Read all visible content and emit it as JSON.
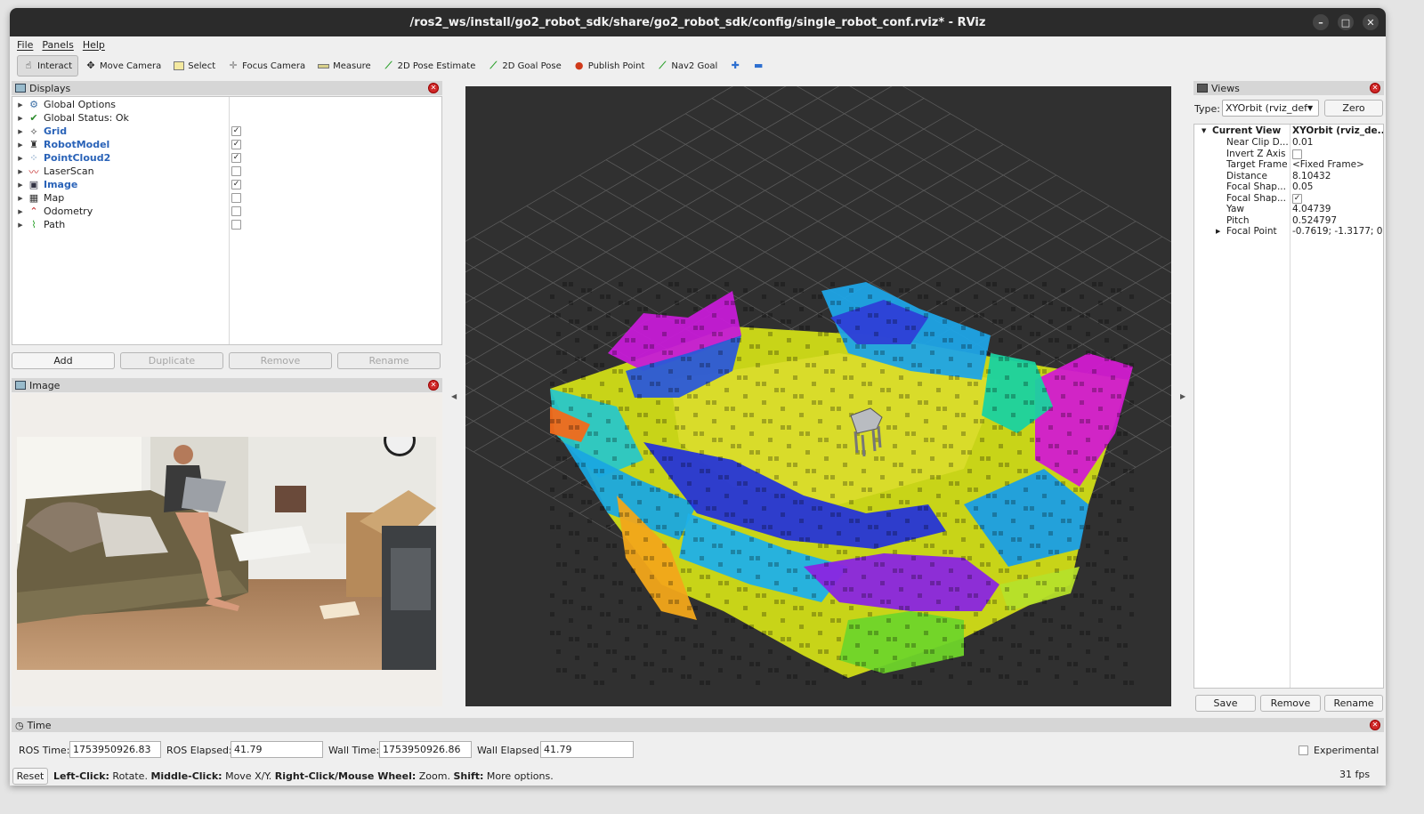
{
  "window": {
    "title": "/ros2_ws/install/go2_robot_sdk/share/go2_robot_sdk/config/single_robot_conf.rviz* - RViz"
  },
  "menu": [
    "File",
    "Panels",
    "Help"
  ],
  "toolbar": [
    {
      "label": "Interact",
      "icon": "cursor-icon"
    },
    {
      "label": "Move Camera",
      "icon": "move-icon"
    },
    {
      "label": "Select",
      "icon": "select-icon"
    },
    {
      "label": "Focus Camera",
      "icon": "focus-icon"
    },
    {
      "label": "Measure",
      "icon": "ruler-icon"
    },
    {
      "label": "2D Pose Estimate",
      "icon": "pose-arrow-icon"
    },
    {
      "label": "2D Goal Pose",
      "icon": "goal-arrow-icon"
    },
    {
      "label": "Publish Point",
      "icon": "pin-icon"
    },
    {
      "label": "Nav2 Goal",
      "icon": "nav-arrow-icon"
    }
  ],
  "displays": {
    "title": "Displays",
    "items": [
      {
        "label": "Global Options",
        "checked": null,
        "blue": false
      },
      {
        "label": "Global Status: Ok",
        "checked": null,
        "blue": false
      },
      {
        "label": "Grid",
        "checked": true,
        "blue": true
      },
      {
        "label": "RobotModel",
        "checked": true,
        "blue": true
      },
      {
        "label": "PointCloud2",
        "checked": true,
        "blue": true
      },
      {
        "label": "LaserScan",
        "checked": false,
        "blue": false
      },
      {
        "label": "Image",
        "checked": true,
        "blue": true
      },
      {
        "label": "Map",
        "checked": false,
        "blue": false
      },
      {
        "label": "Odometry",
        "checked": false,
        "blue": false
      },
      {
        "label": "Path",
        "checked": false,
        "blue": false
      }
    ],
    "buttons": {
      "add": "Add",
      "duplicate": "Duplicate",
      "remove": "Remove",
      "rename": "Rename"
    }
  },
  "image_panel": {
    "title": "Image"
  },
  "views": {
    "title": "Views",
    "type_label": "Type:",
    "type_value": "XYOrbit (rviz_defa",
    "zero": "Zero",
    "current_view": {
      "key": "Current View",
      "value": "XYOrbit (rviz_de..."
    },
    "props": [
      {
        "k": "Near Clip D...",
        "v": "0.01"
      },
      {
        "k": "Invert Z Axis",
        "v": ""
      },
      {
        "k": "Target Frame",
        "v": "<Fixed Frame>"
      },
      {
        "k": "Distance",
        "v": "8.10432"
      },
      {
        "k": "Focal Shap...",
        "v": "0.05"
      },
      {
        "k": "Focal Shap...",
        "v": ""
      },
      {
        "k": "Yaw",
        "v": "4.04739"
      },
      {
        "k": "Pitch",
        "v": "0.524797"
      },
      {
        "k": "Focal Point",
        "v": "-0.7619; -1.3177; 0"
      }
    ],
    "buttons": {
      "save": "Save",
      "remove": "Remove",
      "rename": "Rename"
    }
  },
  "time": {
    "title": "Time",
    "ros_time_label": "ROS Time:",
    "ros_time": "1753950926.83",
    "ros_elapsed_label": "ROS Elapsed:",
    "ros_elapsed": "41.79",
    "wall_time_label": "Wall Time:",
    "wall_time": "1753950926.86",
    "wall_elapsed_label": "Wall Elapsed:",
    "wall_elapsed": "41.79",
    "experimental": "Experimental"
  },
  "status": {
    "reset": "Reset",
    "b1": "Left-Click:",
    "t1": " Rotate. ",
    "b2": "Middle-Click:",
    "t2": " Move X/Y. ",
    "b3": "Right-Click/Mouse Wheel:",
    "t3": " Zoom. ",
    "b4": "Shift:",
    "t4": " More options.",
    "fps": "31 fps"
  }
}
